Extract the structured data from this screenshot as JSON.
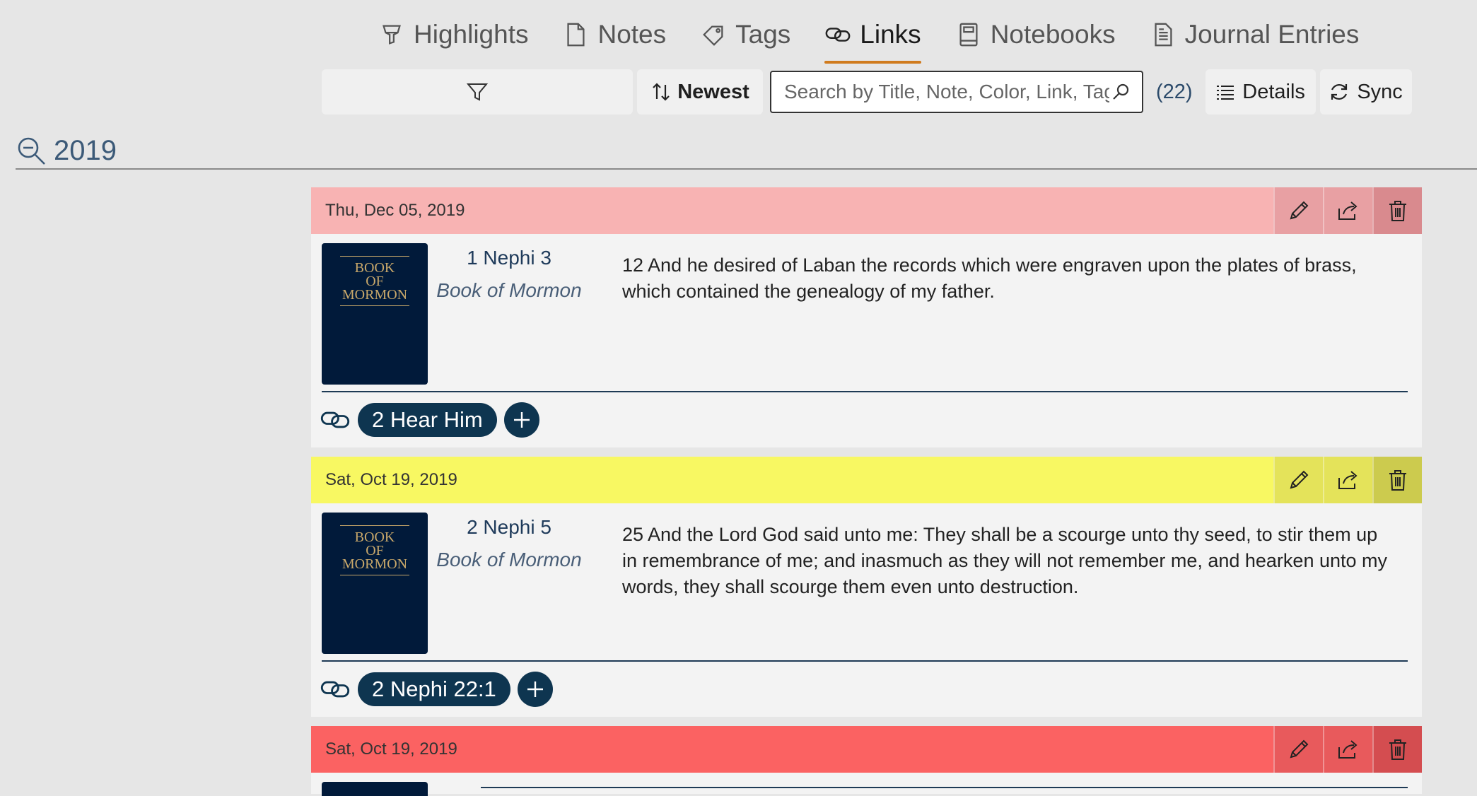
{
  "tabs": [
    {
      "label": "Highlights",
      "icon": "highlighter-icon"
    },
    {
      "label": "Notes",
      "icon": "note-icon"
    },
    {
      "label": "Tags",
      "icon": "tag-icon"
    },
    {
      "label": "Links",
      "icon": "link-icon",
      "active": true
    },
    {
      "label": "Notebooks",
      "icon": "notebook-icon"
    },
    {
      "label": "Journal Entries",
      "icon": "journal-icon"
    }
  ],
  "toolbar": {
    "sort_label": "Newest",
    "search_placeholder": "Search by Title, Note, Color, Link, Tag",
    "count": "(22)",
    "details_label": "Details",
    "sync_label": "Sync"
  },
  "group": {
    "year": "2019"
  },
  "cards": [
    {
      "date": "Thu, Dec 05, 2019",
      "color": "#f8b3b3",
      "button_bg": "#e8a0a3",
      "delete_bg": "#d98a8e",
      "cover_text": [
        "BOOK",
        "OF",
        "MORMON"
      ],
      "chapter": "1 Nephi 3",
      "book": "Book of Mormon",
      "verse": "12 And he desired of Laban the records which were engraven upon the plates of brass, which contained the genealogy of my father.",
      "link": "2 Hear Him"
    },
    {
      "date": "Sat, Oct 19, 2019",
      "color": "#f8f862",
      "button_bg": "#e4e35a",
      "delete_bg": "#cccb4e",
      "cover_text": [
        "BOOK",
        "OF",
        "MORMON"
      ],
      "chapter": "2 Nephi 5",
      "book": "Book of Mormon",
      "verse": "25 And the Lord God said unto me: They shall be a scourge unto thy seed, to stir them up in remembrance of me; and inasmuch as they will not remember me, and hearken unto my words, they shall scourge them even unto destruction.",
      "link": "2 Nephi 22:1"
    },
    {
      "date": "Sat, Oct 19, 2019",
      "color": "#fb6262",
      "button_bg": "#e85a5c",
      "delete_bg": "#d44d50"
    }
  ]
}
